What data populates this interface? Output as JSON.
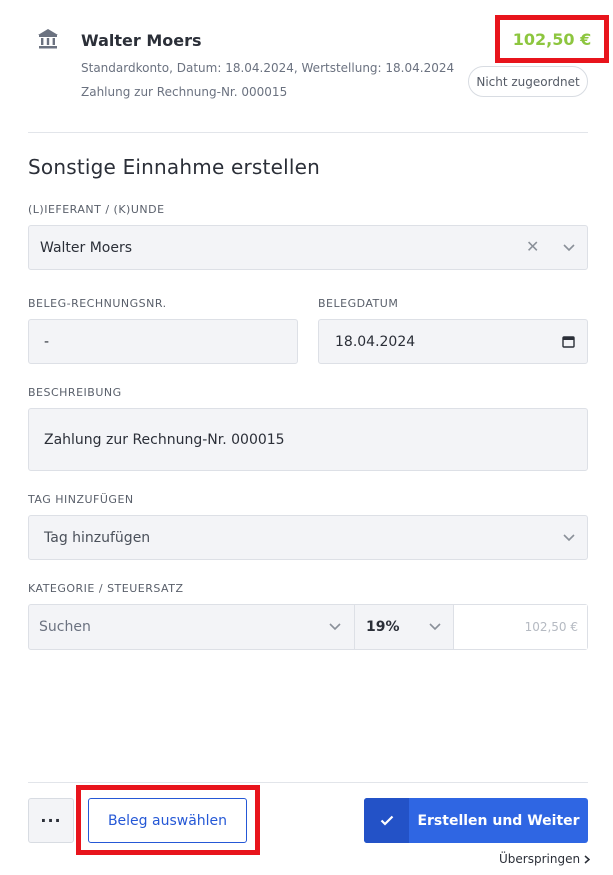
{
  "transaction": {
    "name": "Walter Moers",
    "meta_line1": "Standardkonto, Datum: 18.04.2024, Wertstellung: 18.04.2024",
    "meta_line2": "Zahlung zur Rechnung-Nr. 000015",
    "amount": "102,50 €",
    "status": "Nicht zugeordnet",
    "icon": "bank-icon"
  },
  "form": {
    "title": "Sonstige Einnahme erstellen",
    "supplier": {
      "label": "(L)IEFERANT / (K)UNDE",
      "value": "Walter Moers"
    },
    "invoice_no": {
      "label": "BELEG-RECHNUNGSNR.",
      "value": "-"
    },
    "invoice_date": {
      "label": "BELEGDATUM",
      "value": "18.04.2024"
    },
    "description": {
      "label": "BESCHREIBUNG",
      "value": "Zahlung zur Rechnung-Nr. 000015"
    },
    "tag": {
      "label": "TAG HINZUFÜGEN",
      "placeholder": "Tag hinzufügen"
    },
    "category": {
      "label": "KATEGORIE / STEUERSATZ",
      "search_placeholder": "Suchen",
      "tax_rate": "19%",
      "amount": "102,50 €"
    }
  },
  "footer": {
    "more_label": "···",
    "select_receipt_label": "Beleg auswählen",
    "create_next_label": "Erstellen und Weiter",
    "skip_label": "Überspringen"
  },
  "colors": {
    "accent": "#2f66e3",
    "amount_positive": "#8dc63f",
    "highlight": "#e8141c"
  }
}
